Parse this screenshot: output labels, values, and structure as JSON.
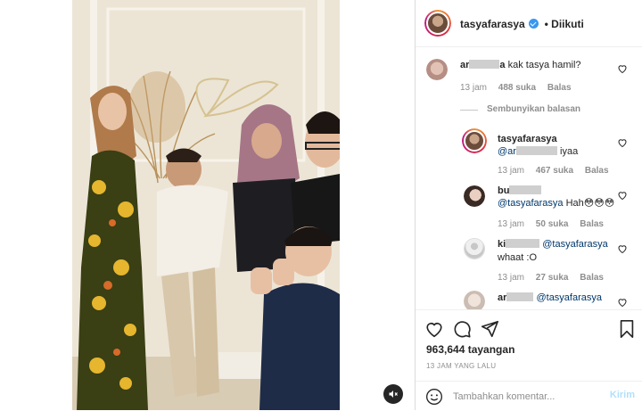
{
  "post": {
    "author": "tasyafarasya",
    "follow_status": "• Diikuti",
    "views": "963,644 tayangan",
    "date": "13 JAM YANG LALU"
  },
  "comments": [
    {
      "user_visible": "ar",
      "user_tail": "a",
      "text": "kak tasya hamil?",
      "time": "13 jam",
      "likes": "488 suka",
      "reply": "Balas"
    }
  ],
  "hide_replies": "Sembunyikan balasan",
  "replies": [
    {
      "user": "tasyafarasya",
      "mention_prefix": "@ar",
      "text": "iyaa",
      "time": "13 jam",
      "likes": "467 suka",
      "reply": "Balas"
    },
    {
      "user_visible": "bu",
      "mention": "@tasyafarasya",
      "text": "Hah😳😳😳",
      "time": "13 jam",
      "likes": "50 suka",
      "reply": "Balas"
    },
    {
      "user_visible": "ki",
      "mention": "@tasyafarasya",
      "text": "whaat :O",
      "time": "13 jam",
      "likes": "27 suka",
      "reply": "Balas"
    },
    {
      "user_visible": "ar",
      "mention": "@tasyafarasya",
      "text": ""
    }
  ],
  "composer": {
    "placeholder": "Tambahkan komentar...",
    "post_label": "Kirim"
  },
  "icons": {
    "like": "heart-icon",
    "comment": "comment-icon",
    "share": "paper-plane-icon",
    "save": "bookmark-icon",
    "emoji": "smiley-icon",
    "mute": "speaker-muted-icon"
  },
  "colors": {
    "link": "#00376b",
    "meta": "#8e8e8e",
    "verified": "#3897f0",
    "post_disabled": "#b2dffc"
  }
}
